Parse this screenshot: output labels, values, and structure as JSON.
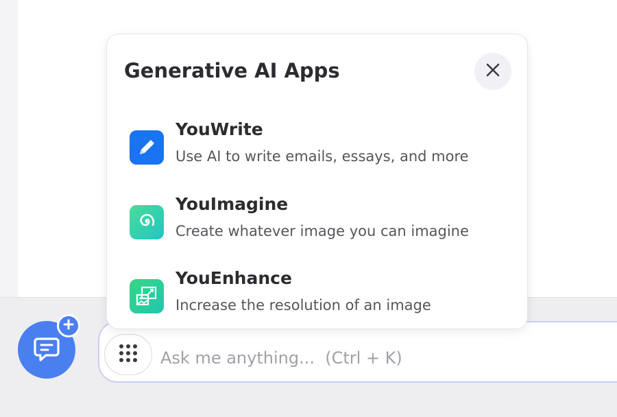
{
  "popup": {
    "title": "Generative AI Apps",
    "close_icon": "close-icon",
    "apps": [
      {
        "name": "YouWrite",
        "description": "Use AI to write emails, essays, and more",
        "icon": "pencil-icon",
        "icon_color": "#1a73f0"
      },
      {
        "name": "YouImagine",
        "description": "Create whatever image you can imagine",
        "icon": "spiral-icon",
        "icon_color": "#2ecfb0"
      },
      {
        "name": "YouEnhance",
        "description": "Increase the resolution of an image",
        "icon": "image-enhance-icon",
        "icon_color": "#21c79a"
      }
    ]
  },
  "search": {
    "placeholder": "Ask me anything...  (Ctrl + K)",
    "apps_icon": "grid-dots-icon"
  },
  "chat_button": {
    "icon": "chat-bubble-icon",
    "badge_icon": "plus-icon",
    "color": "#4a7ff0"
  }
}
